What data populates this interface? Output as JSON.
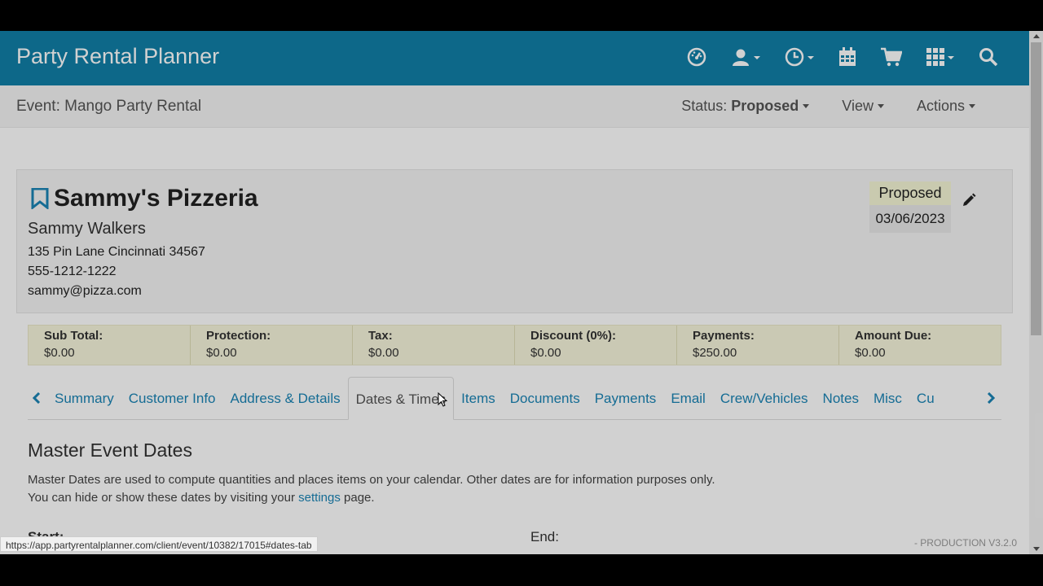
{
  "navbar": {
    "brand": "Party Rental Planner",
    "icons": [
      "dashboard-icon",
      "user-icon",
      "clock-icon",
      "calendar-icon",
      "cart-icon",
      "apps-grid-icon",
      "search-icon"
    ]
  },
  "subheader": {
    "event_title": "Event: Mango Party Rental",
    "status_label": "Status:",
    "status_value": "Proposed",
    "view_label": "View",
    "actions_label": "Actions"
  },
  "customer": {
    "company": "Sammy's Pizzeria",
    "contact": "Sammy Walkers",
    "address": "135 Pin Lane Cincinnati 34567",
    "phone": "555-1212-1222",
    "email": "sammy@pizza.com",
    "status": "Proposed",
    "date": "03/06/2023"
  },
  "summary": [
    {
      "label": "Sub Total:",
      "value": "$0.00"
    },
    {
      "label": "Protection:",
      "value": "$0.00"
    },
    {
      "label": "Tax:",
      "value": "$0.00"
    },
    {
      "label": "Discount (0%):",
      "value": "$0.00"
    },
    {
      "label": "Payments:",
      "value": "$250.00"
    },
    {
      "label": "Amount Due:",
      "value": "$0.00"
    }
  ],
  "tabs": [
    "Summary",
    "Customer Info",
    "Address & Details",
    "Dates & Times",
    "Items",
    "Documents",
    "Payments",
    "Email",
    "Crew/Vehicles",
    "Notes",
    "Misc",
    "Cu"
  ],
  "active_tab": "Dates & Times",
  "content": {
    "title": "Master Event Dates",
    "line1": "Master Dates are used to compute quantities and places items on your calendar. Other dates are for information purposes only.",
    "line2_before": "You can hide or show these dates by visiting your ",
    "line2_link": "settings",
    "line2_after": " page.",
    "start_label": "Start:",
    "end_label": "End:"
  },
  "footer": {
    "production": "- PRODUCTION V3.2.0",
    "status_url": "https://app.partyrentalplanner.com/client/event/10382/17015#dates-tab"
  },
  "colors": {
    "navbar": "#117fa8",
    "link": "#1a84b5",
    "summary_bg": "#f7f6dc"
  }
}
